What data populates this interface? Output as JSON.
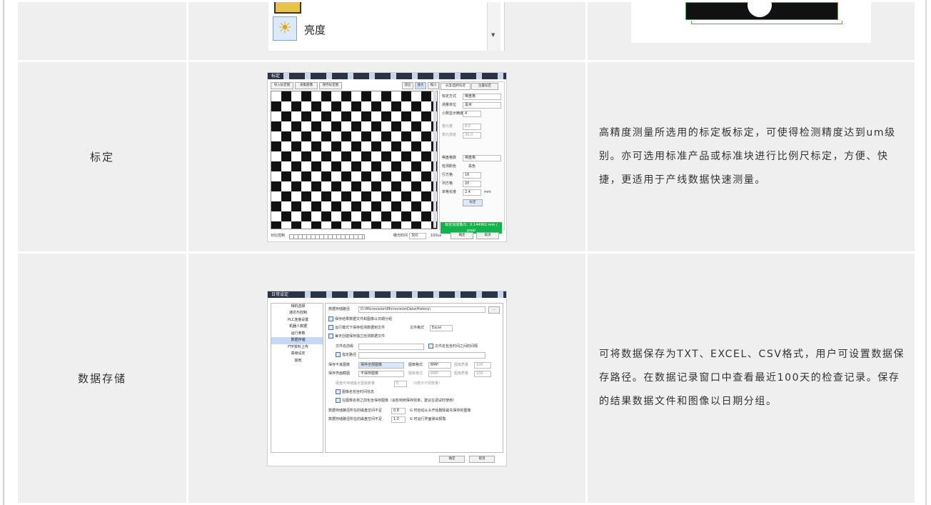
{
  "row0": {
    "list_label": "亮度"
  },
  "calib": {
    "name": "标定",
    "description": "高精度测量所选用的标定板标定，可使得检测精度达到um级别。亦可选用标准产品或标准块进行比例尺标定，方便、快捷，更适用于产线数据快速测量。",
    "shot": {
      "window_title": "标定",
      "tab_active": "长度/面积标定",
      "tab_other": "位置标定",
      "left_buttons": [
        "导入标定图",
        "采集图像",
        "保存标定图"
      ],
      "zoom_buttons": [
        "适应",
        "放大",
        "缩小"
      ],
      "form_labels": [
        "标定方式",
        "测量单位",
        "小数显示精度",
        "像元宽",
        "像元高度",
        "棋盘格数",
        "检测颜色",
        "行方格",
        "列方格",
        "单格长度"
      ],
      "form_values": [
        "棋盘格",
        "毫米",
        "4",
        "8.0",
        "30.0",
        "棋盘格",
        "黑色",
        "16",
        "20",
        "2.4"
      ],
      "unit_mm": "mm",
      "apply_button": "标定",
      "status": "标定完成像元：0.144962 mm / pixel",
      "bottom_left": "对比控制",
      "bottom_mid": "曝光时间",
      "bottom_value": "300",
      "bottom_unit": "100us",
      "ok_button": "确定",
      "cancel_button": "取消"
    }
  },
  "storage": {
    "name": "数据存储",
    "description": "可将数据保存为TXT、EXCEL、CSV格式，用户可设置数据保存路径。在数据记录窗口中查看最近100天的检查记录。保存的结果数据文件和图像以日期分组。",
    "shot": {
      "window_title": "日常设定",
      "menu": [
        "相机选择",
        "通讯与控制",
        "PLC连接设置",
        "机器人数据",
        "运行参数",
        "数据存储",
        "FTP资料上传",
        "高级设定",
        "其他"
      ],
      "path_label": "数据存储路径",
      "path_value": "D:\\Microvision\\MicrovisionData\\History\\",
      "browse": "...",
      "check1": "保存结果数据文件和图像以日期分组",
      "check2": "运行模式下保存检测数据到文件",
      "file_format_label": "文件格式",
      "file_format_value": "Excel",
      "check3": "每天创建保存独立检测数据文件",
      "file_name_label": "文件名前缀",
      "check4": "文件名包含时间之间的间隔",
      "check5": "指定路径",
      "save_img_label": "保存不良图像",
      "save_img_value": "保存全部图像",
      "img_format_label": "图像格式",
      "img_format_value": "BMP",
      "img_quality_label": "图像质量",
      "img_quality_value": "100",
      "save_screen_label": "保存界面截图",
      "save_screen_value": "不保存图像",
      "screen_format_label": "图像格式",
      "screen_format_value": "BMP",
      "screen_quality_label": "图像质量",
      "screen_quality_value": "100",
      "max_label": "硬盘可存储最大图像数量",
      "max_value": "0",
      "max_hint": "（0表示不限数量）",
      "check6": "图像名包含时间信息",
      "check7": "在图像名称之前包含保存图像（会影响到保存效率，建议在调试时使用）",
      "disk1_label": "数据存储路径所在的磁盘空间不足",
      "disk1_value": "0.8",
      "disk1_hint": "G 时自动从头开始删除最先保存的图像",
      "disk2_label": "数据存储路径所在的磁盘空间不足",
      "disk2_value": "1.0",
      "disk2_hint": "G 时运行界面弹出报警",
      "ok_button": "确定",
      "cancel_button": "取消"
    }
  }
}
